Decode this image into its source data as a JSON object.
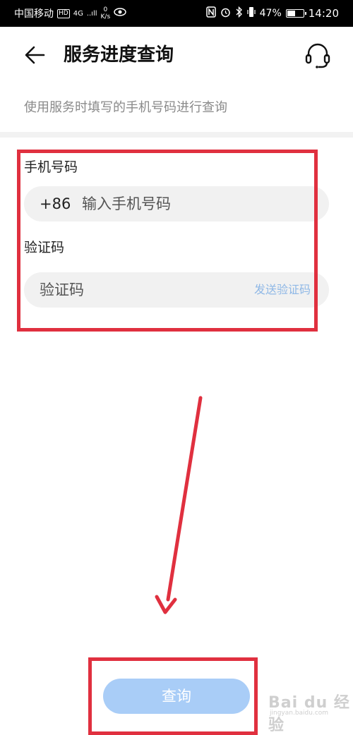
{
  "status_bar": {
    "carrier": "中国移动",
    "hd": "HD",
    "network": "4G",
    "signal": "..ıll",
    "speed_value": "0",
    "speed_unit": "K/s",
    "battery": "47%",
    "battery_level": 0.47,
    "time": "14:20"
  },
  "header": {
    "title": "服务进度查询"
  },
  "subtitle": "使用服务时填写的手机号码进行查询",
  "form": {
    "phone_label": "手机号码",
    "phone_prefix": "+86",
    "phone_placeholder": "输入手机号码",
    "code_label": "验证码",
    "code_placeholder": "验证码",
    "send_code_label": "发送验证码"
  },
  "query_button": "查询",
  "watermark": {
    "logo_text": "Bai du 经验",
    "url": "jingyan.baidu.com"
  },
  "colors": {
    "annotation_red": "#e0303f",
    "button_blue": "#a9cdf7",
    "send_link_blue": "#8fb8e6"
  }
}
